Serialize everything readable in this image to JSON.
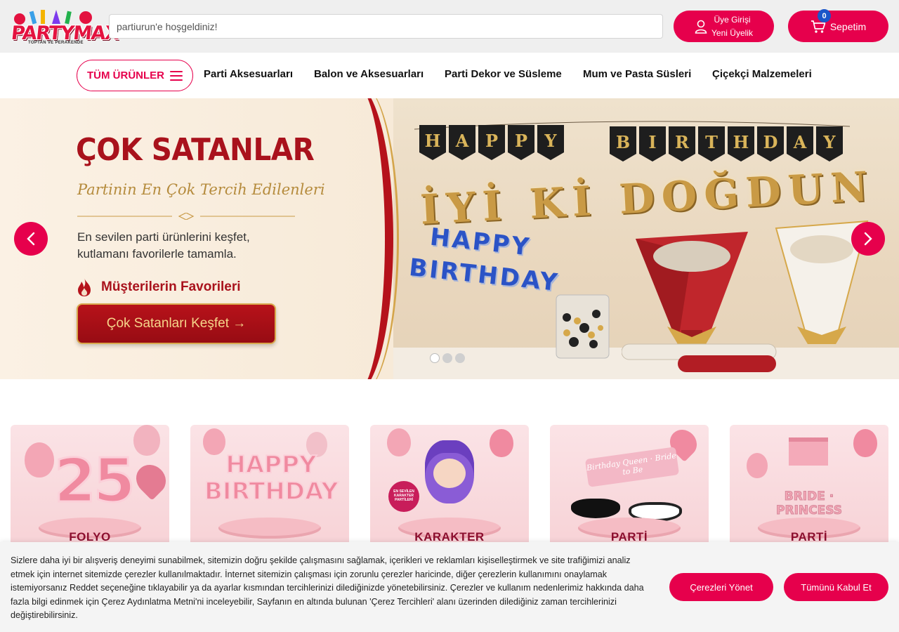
{
  "header": {
    "logo_text": "PARTYMAX",
    "logo_tagline": "TOPTAN VE PERAKENDE",
    "search_placeholder": "partiurun'e hoşgeldiniz!",
    "login_line1": "Üye Girişi",
    "login_line2": "Yeni Üyelik",
    "cart_label": "Sepetim",
    "cart_count": "0"
  },
  "nav": {
    "all_products": "TÜM ÜRÜNLER",
    "items": [
      "Parti Aksesuarları",
      "Balon ve Aksesuarları",
      "Parti Dekor ve Süsleme",
      "Mum ve Pasta Süsleri",
      "Çiçekçi Malzemeleri"
    ]
  },
  "hero": {
    "title": "ÇOK SATANLAR",
    "subtitle": "Partinin En Çok Tercih Edilenleri",
    "description": "En sevilen parti ürünlerini keşfet, kutlamanı favorilerle tamamla.",
    "favorites_label": "Müşterilerin Favorileri",
    "cta_label": "Çok Satanları Keşfet →",
    "banner_word1": [
      "H",
      "A",
      "P",
      "P",
      "Y"
    ],
    "banner_word2": [
      "B",
      "I",
      "R",
      "T",
      "H",
      "D",
      "A",
      "Y"
    ],
    "gold_text": "İYİ Kİ DOĞDUN",
    "blue_line1": "HAPPY",
    "blue_line2": "BIRTHDAY",
    "slide_count": 3,
    "active_slide": 1
  },
  "categories": [
    {
      "image_text": "25",
      "label": "FOLYO"
    },
    {
      "image_text": "HAPPY BIRTHDAY",
      "label": ""
    },
    {
      "image_text": "EN SEVİLEN KARAKTER PARTİLERİ",
      "label": "KARAKTER"
    },
    {
      "image_text": "Birthday Queen · Bride to Be",
      "label": "PARTİ"
    },
    {
      "image_text": "BRIDE · PRINCESS",
      "label": "PARTİ"
    }
  ],
  "cookie": {
    "text": "Sizlere daha iyi bir alışveriş deneyimi sunabilmek, sitemizin doğru şekilde çalışmasını sağlamak, içerikleri ve reklamları kişiselleştirmek ve site trafiğimizi analiz etmek için internet sitemizde çerezler kullanılmaktadır. İnternet sitemizin çalışması için zorunlu çerezler haricinde, diğer çerezlerin kullanımını onaylamak istemiyorsanız Reddet seçeneğine tıklayabilir ya da ayarlar kısmından tercihlerinizi dilediğinizde yönetebilirsiniz. Çerezler ve kullanım nedenlerimiz hakkında daha fazla bilgi edinmek için Çerez Aydınlatma Metni'ni inceleyebilir, Sayfanın en altında bulunan 'Çerez Tercihleri' alanı üzerinden dilediğiniz zaman tercihlerinizi değiştirebilirsiniz.",
    "manage_label": "Çerezleri Yönet",
    "accept_label": "Tümünü Kabul Et"
  },
  "colors": {
    "brand_pink": "#e6004c",
    "hero_red": "#a9121c",
    "gold": "#c99a45",
    "badge_blue": "#1a56c9"
  },
  "icons": [
    "user-icon",
    "cart-icon",
    "menu-icon",
    "chevron-left-icon",
    "chevron-right-icon",
    "flame-icon"
  ]
}
